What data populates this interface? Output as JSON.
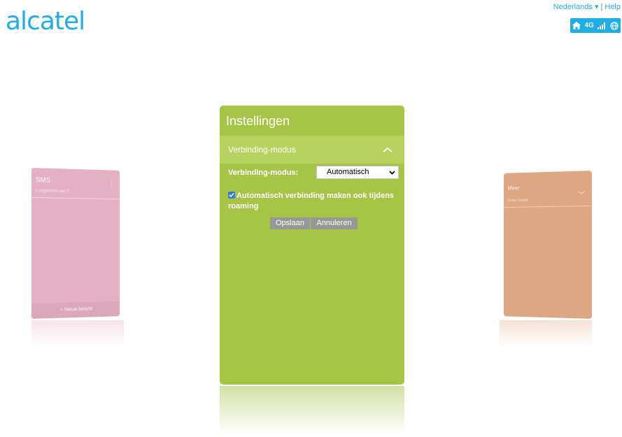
{
  "brand": {
    "logo_text": "alcatel",
    "accent": "#1daee8"
  },
  "header": {
    "language": "Nederlands",
    "language_icon": "caret-down-icon",
    "separator": "|",
    "help": "Help",
    "status": {
      "home_icon": "home-icon",
      "network": "4G",
      "signal_icon": "signal-icon",
      "globe_icon": "globe-icon"
    }
  },
  "left_card": {
    "title": "SMS",
    "subtitle": "0 ongelezen van 0",
    "footer": "Nieuw bericht",
    "color": "#e3b0c4"
  },
  "right_card": {
    "title": "Meer",
    "subtitle": "Online Update",
    "color": "#dda783"
  },
  "main_card": {
    "title": "Instellingen",
    "color": "#a6c445",
    "section_title": "Verbinding-modus",
    "mode_label": "Verbinding-modus:",
    "mode_value": "Automatisch",
    "roaming_label": "Automatisch verbinding maken ook tijdens roaming",
    "roaming_checked": true,
    "save_label": "Opslaan",
    "cancel_label": "Annuleren"
  }
}
